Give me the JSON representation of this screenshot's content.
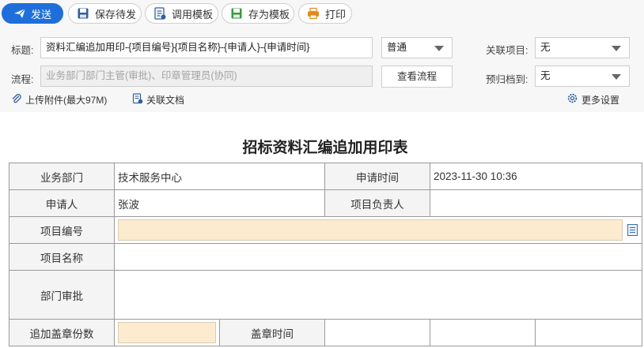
{
  "toolbar": {
    "send": "发送",
    "save_draft": "保存待发",
    "use_template": "调用模板",
    "save_template": "存为模板",
    "print": "打印"
  },
  "header": {
    "title_label": "标题:",
    "title_value": "资料汇编追加用印-{项目编号}{项目名称}-{申请人}-{申请时间}",
    "priority_value": "普通",
    "related_project_label": "关联项目:",
    "related_project_value": "无",
    "flow_label": "流程:",
    "flow_value": "业务部门部门主管(审批)、印章管理员(协同)",
    "view_flow_button": "查看流程",
    "archive_label": "预归档到:",
    "archive_value": "无",
    "upload_attachment": "上传附件(最大97M)",
    "related_docs": "关联文档",
    "more_settings": "更多设置"
  },
  "form": {
    "title": "招标资料汇编追加用印表",
    "dept_label": "业务部门",
    "dept_value": "技术服务中心",
    "apply_time_label": "申请时间",
    "apply_time_value": "2023-11-30 10:36",
    "applicant_label": "申请人",
    "applicant_value": "张波",
    "project_lead_label": "项目负责人",
    "project_lead_value": "",
    "project_no_label": "项目编号",
    "project_name_label": "项目名称",
    "dept_approval_label": "部门审批",
    "seal_count_label": "追加盖章份数",
    "seal_time_label": "盖章时间"
  },
  "colors": {
    "primary": "#1e6fd9",
    "input_highlight": "#fdebcf",
    "toolbar_bg": "#f7f7f7"
  },
  "icons": [
    "send-icon",
    "save-icon",
    "template-icon",
    "save-template-icon",
    "print-icon",
    "paperclip-icon",
    "related-doc-icon",
    "gear-icon",
    "caret-down-icon",
    "list-icon"
  ]
}
